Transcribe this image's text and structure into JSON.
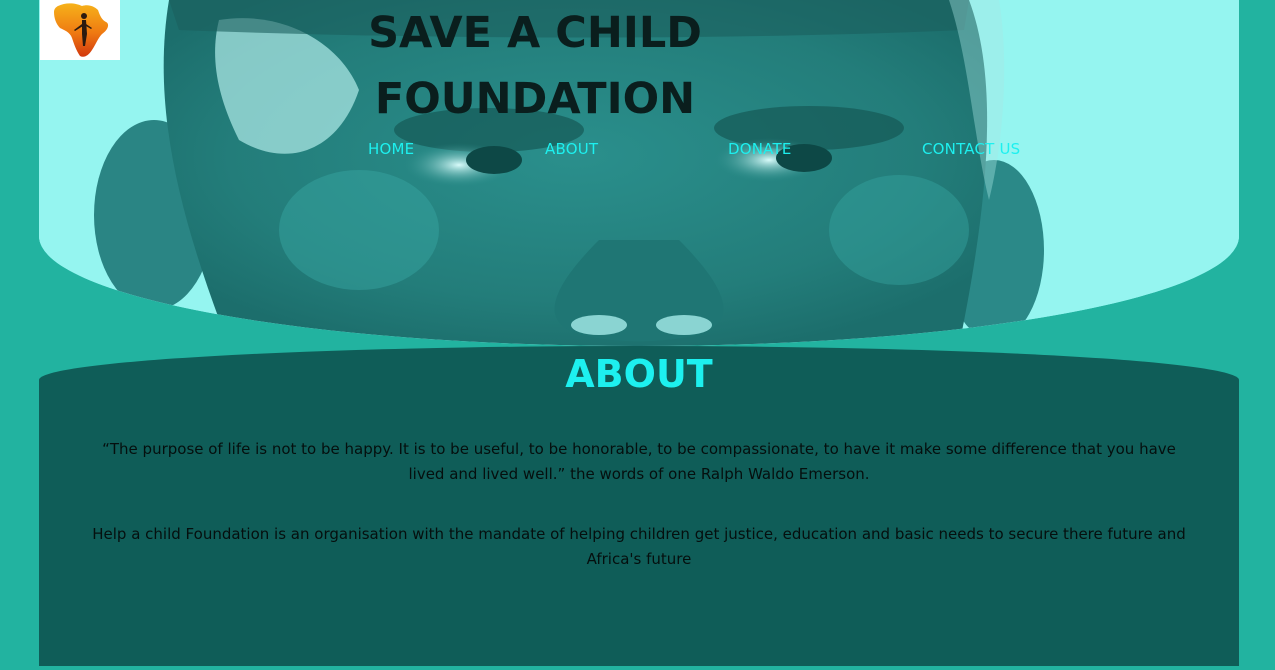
{
  "site": {
    "title": "SAVE A CHILD FOUNDATION"
  },
  "nav": {
    "items": [
      {
        "label": "HOME"
      },
      {
        "label": "ABOUT"
      },
      {
        "label": "DONATE"
      },
      {
        "label": "CONTACT US"
      }
    ]
  },
  "logo": {
    "icon": "africa-map-child-icon"
  },
  "about": {
    "heading": "ABOUT",
    "quote": "“The purpose of life is not to be happy. It is to be useful, to be honorable, to be compassionate, to have it make some difference that you have lived and lived well.” the words of one Ralph Waldo Emerson.",
    "mission": "Help a child Foundation is an organisation with the mandate of helping children get justice, education and basic needs to secure there future and Africa's future"
  },
  "colors": {
    "page_background": "#22b3a0",
    "hero_tint": "#95f5f0",
    "about_background": "#0f5d58",
    "accent": "#1df0ef",
    "title_text": "#0a1e1d"
  }
}
